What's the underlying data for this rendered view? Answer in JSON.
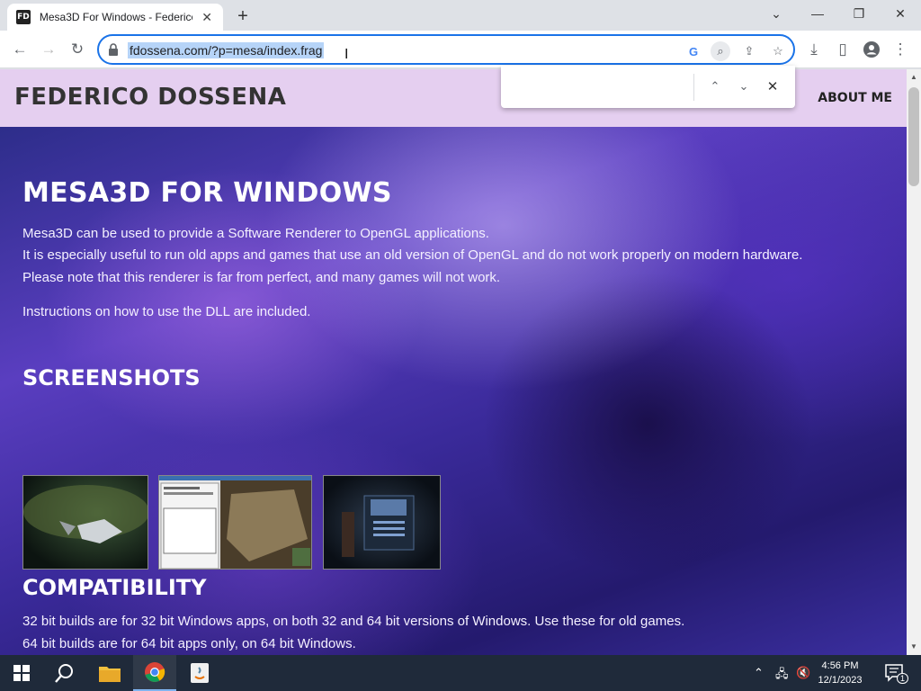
{
  "browser": {
    "tab_title": "Mesa3D For Windows - Federico",
    "favicon_text": "FD",
    "url": "fdossena.com/?p=mesa/index.frag"
  },
  "find_bar": {
    "query": ""
  },
  "site": {
    "name": "FEDERICO DOSSENA",
    "nav_about": "ABOUT ME"
  },
  "page": {
    "title": "MESA3D FOR WINDOWS",
    "intro_lines": [
      "Mesa3D can be used to provide a Software Renderer to OpenGL applications.",
      "It is especially useful to run old apps and games that use an old version of OpenGL and do not work properly on modern hardware.",
      "Please note that this renderer is far from perfect, and many games will not work."
    ],
    "instructions": "Instructions on how to use the DLL are included.",
    "screenshots_heading": "SCREENSHOTS",
    "compat_heading": "COMPATIBILITY",
    "compat_lines": [
      "32 bit builds are for 32 bit Windows apps, on both 32 and 64 bit versions of Windows. Use these for old games.",
      "64 bit builds are for 64 bit apps only, on 64 bit Windows."
    ]
  },
  "taskbar": {
    "time": "4:56 PM",
    "date": "12/1/2023",
    "notification_count": "1"
  },
  "colors": {
    "accent": "#1a73e8",
    "header_bg": "#e5cff0",
    "taskbar": "#1f2a3a"
  }
}
